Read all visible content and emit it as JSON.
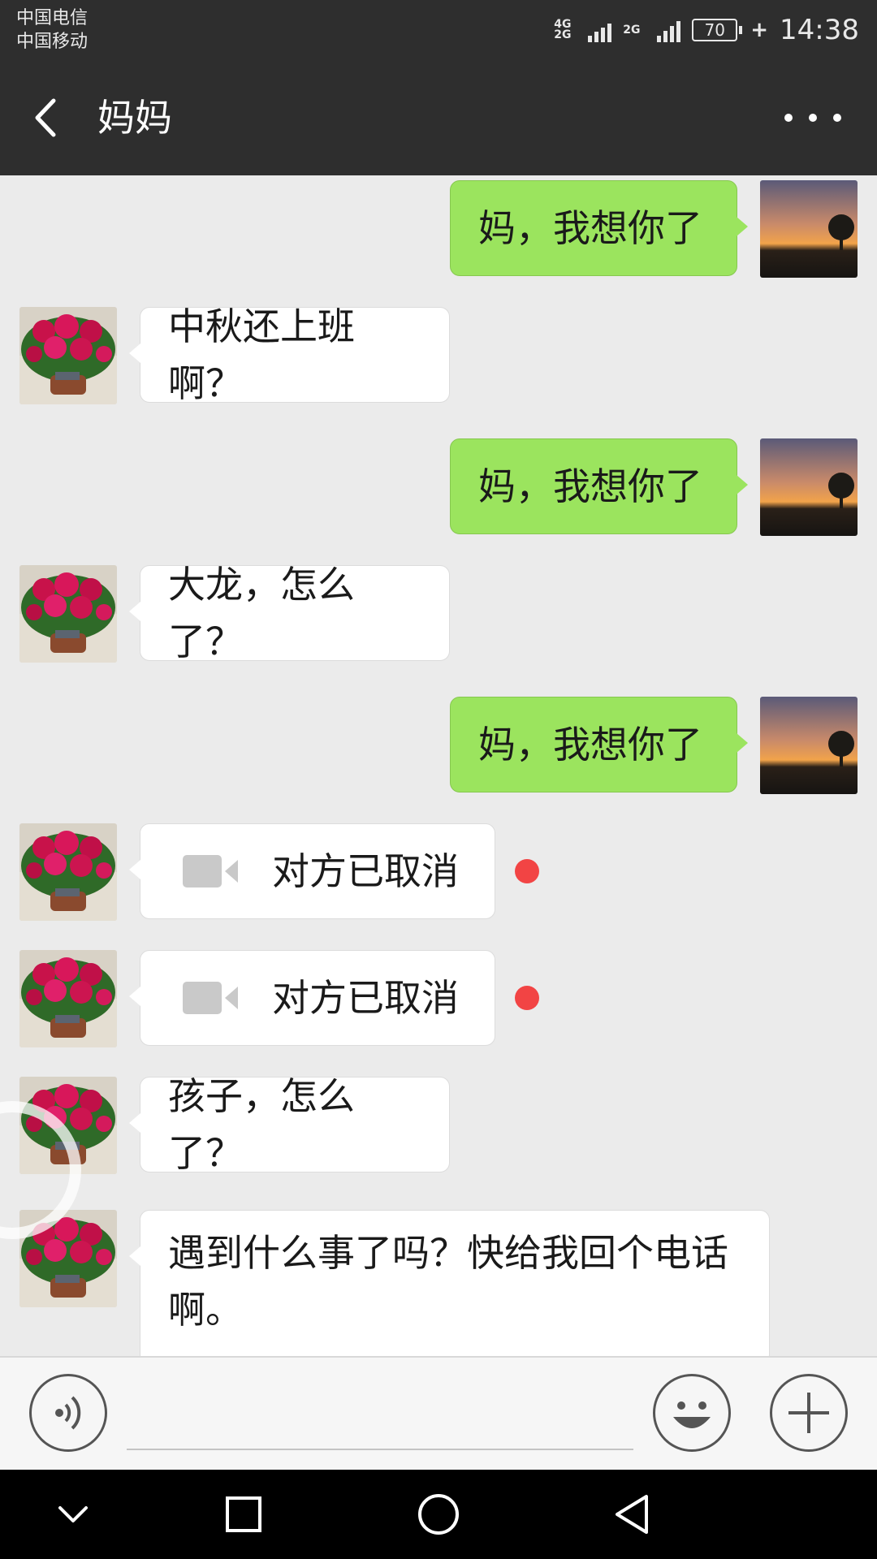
{
  "status_bar": {
    "carrier_1": "中国电信",
    "carrier_2": "中国移动",
    "network_1": "4G",
    "network_2": "2G",
    "network_3": "2G",
    "battery": "70",
    "time": "14:38"
  },
  "header": {
    "title": "妈妈",
    "back_icon": "chevron-left-icon",
    "more_icon": "more-dots-icon"
  },
  "messages": [
    {
      "direction": "out",
      "text": "妈，我想你了"
    },
    {
      "direction": "in",
      "text": "中秋还上班啊？"
    },
    {
      "direction": "out",
      "text": "妈，我想你了"
    },
    {
      "direction": "in",
      "text": "大龙，怎么了？"
    },
    {
      "direction": "out",
      "text": "妈，我想你了"
    },
    {
      "direction": "in",
      "type": "video-call",
      "text": "对方已取消",
      "unread": true
    },
    {
      "direction": "in",
      "type": "video-call",
      "text": "对方已取消",
      "unread": true
    },
    {
      "direction": "in",
      "text": "孩子，怎么了？"
    },
    {
      "direction": "in",
      "text": "遇到什么事了吗？快给我回个电话啊。"
    }
  ],
  "input_bar": {
    "value": "",
    "voice_icon": "voice-icon",
    "emoji_icon": "emoji-icon",
    "plus_icon": "plus-icon"
  },
  "colors": {
    "out_bubble": "#9be45e",
    "in_bubble": "#ffffff",
    "header_bg": "#2e2e2e",
    "unread_dot": "#f24444",
    "chat_bg": "#ebebeb"
  }
}
